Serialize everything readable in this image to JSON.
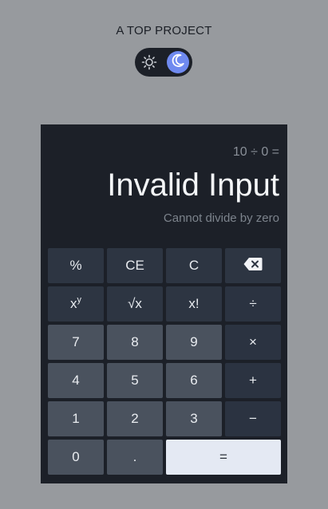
{
  "header": {
    "title": "A TOP PROJECT"
  },
  "theme_toggle": {
    "left_icon": "sun-icon",
    "right_icon": "moon-icon",
    "active": "dark",
    "colors": {
      "track": "#1c2028",
      "knob": "#6f8af0"
    }
  },
  "display": {
    "expression": "10 ÷ 0 =",
    "result": "Invalid Input",
    "message": "Cannot divide by zero"
  },
  "keys": {
    "percent": "%",
    "clear_entry": "CE",
    "clear": "C",
    "backspace_icon": "backspace-icon",
    "power_base": "x",
    "power_exp": "y",
    "sqrt": "√x",
    "factorial": "x!",
    "divide": "÷",
    "seven": "7",
    "eight": "8",
    "nine": "9",
    "multiply": "×",
    "four": "4",
    "five": "5",
    "six": "6",
    "plus": "+",
    "one": "1",
    "two": "2",
    "three": "3",
    "minus": "−",
    "zero": "0",
    "decimal": ".",
    "equals": "="
  },
  "colors": {
    "page_bg": "#979a9e",
    "calculator_bg": "#1c2028",
    "function_key": "#2d3542",
    "number_key": "#4a525e",
    "equals_key": "#e4e9f3"
  }
}
